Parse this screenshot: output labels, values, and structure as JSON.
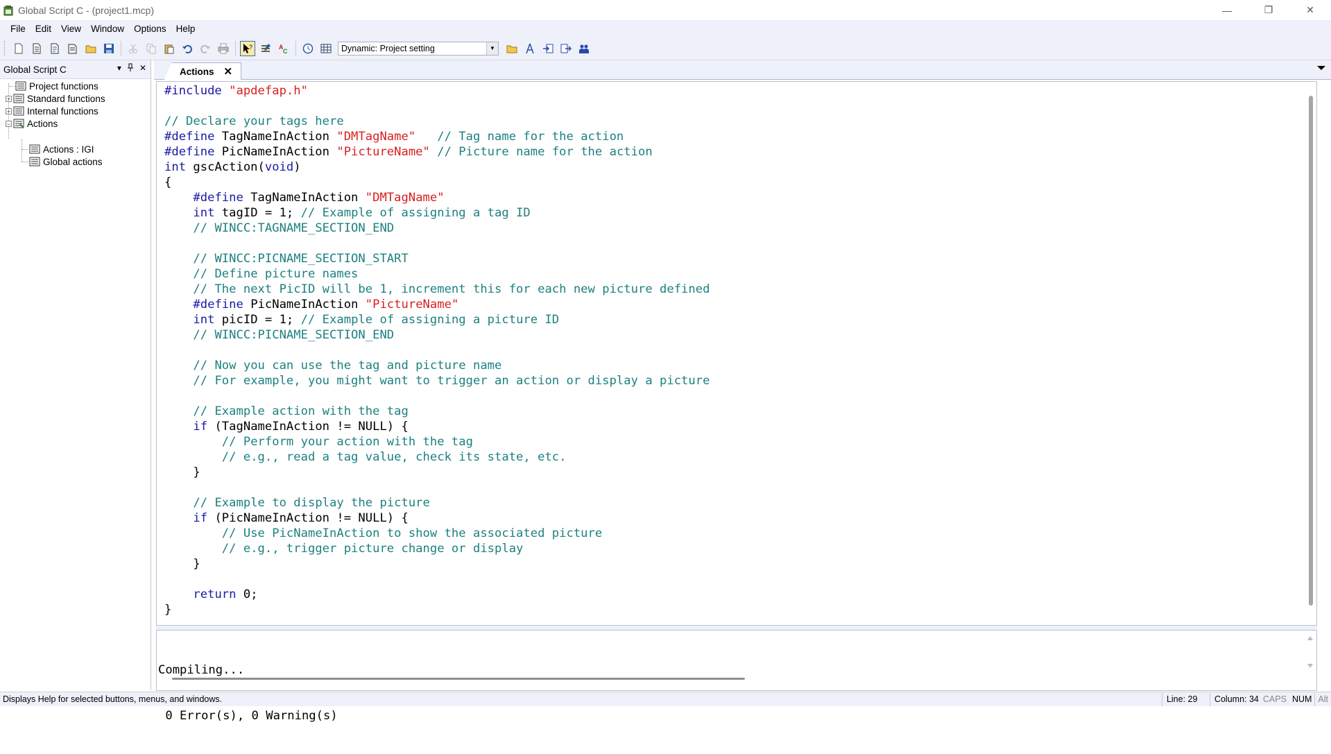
{
  "window": {
    "title": "Global Script C - (project1.mcp)",
    "minimize_glyph": "—",
    "restore_glyph": "❐",
    "close_glyph": "✕"
  },
  "menu": [
    "File",
    "Edit",
    "View",
    "Window",
    "Options",
    "Help"
  ],
  "toolbar": {
    "dynamic_combo_value": "Dynamic: Project setting"
  },
  "left_panel": {
    "title": "Global Script C",
    "ctrl_dropdown": "▾",
    "ctrl_pin": "ꟷ",
    "ctrl_close": "✕",
    "tree": [
      {
        "label": "Project functions",
        "expander": ""
      },
      {
        "label": "Standard functions",
        "expander": "+"
      },
      {
        "label": "Internal functions",
        "expander": "+"
      },
      {
        "label": "Actions",
        "expander": "−"
      },
      {
        "label": "Actions : IGI",
        "expander": ""
      },
      {
        "label": "Global actions",
        "expander": ""
      }
    ]
  },
  "tab": {
    "label": "Actions",
    "close": "✕"
  },
  "code_lines": [
    [
      {
        "t": "kw",
        "v": "#include "
      },
      {
        "t": "str",
        "v": "\"apdefap.h\""
      }
    ],
    [],
    [
      {
        "t": "cm",
        "v": "// Declare your tags here"
      }
    ],
    [
      {
        "t": "kw",
        "v": "#define"
      },
      {
        "t": "n",
        "v": " TagNameInAction "
      },
      {
        "t": "str",
        "v": "\"DMTagName\""
      },
      {
        "t": "n",
        "v": "   "
      },
      {
        "t": "cm",
        "v": "// Tag name for the action"
      }
    ],
    [
      {
        "t": "kw",
        "v": "#define"
      },
      {
        "t": "n",
        "v": " PicNameInAction "
      },
      {
        "t": "str",
        "v": "\"PictureName\""
      },
      {
        "t": "n",
        "v": " "
      },
      {
        "t": "cm",
        "v": "// Picture name for the action"
      }
    ],
    [
      {
        "t": "kw",
        "v": "int"
      },
      {
        "t": "n",
        "v": " gscAction("
      },
      {
        "t": "kw",
        "v": "void"
      },
      {
        "t": "n",
        "v": ")"
      }
    ],
    [
      {
        "t": "n",
        "v": "{"
      }
    ],
    [
      {
        "t": "n",
        "v": "    "
      },
      {
        "t": "kw",
        "v": "#define"
      },
      {
        "t": "n",
        "v": " TagNameInAction "
      },
      {
        "t": "str",
        "v": "\"DMTagName\""
      }
    ],
    [
      {
        "t": "n",
        "v": "    "
      },
      {
        "t": "kw",
        "v": "int"
      },
      {
        "t": "n",
        "v": " tagID = 1; "
      },
      {
        "t": "cm",
        "v": "// Example of assigning a tag ID"
      }
    ],
    [
      {
        "t": "n",
        "v": "    "
      },
      {
        "t": "cm",
        "v": "// WINCC:TAGNAME_SECTION_END"
      }
    ],
    [],
    [
      {
        "t": "n",
        "v": "    "
      },
      {
        "t": "cm",
        "v": "// WINCC:PICNAME_SECTION_START"
      }
    ],
    [
      {
        "t": "n",
        "v": "    "
      },
      {
        "t": "cm",
        "v": "// Define picture names"
      }
    ],
    [
      {
        "t": "n",
        "v": "    "
      },
      {
        "t": "cm",
        "v": "// The next PicID will be 1, increment this for each new picture defined"
      }
    ],
    [
      {
        "t": "n",
        "v": "    "
      },
      {
        "t": "kw",
        "v": "#define"
      },
      {
        "t": "n",
        "v": " PicNameInAction "
      },
      {
        "t": "str",
        "v": "\"PictureName\""
      }
    ],
    [
      {
        "t": "n",
        "v": "    "
      },
      {
        "t": "kw",
        "v": "int"
      },
      {
        "t": "n",
        "v": " picID = 1; "
      },
      {
        "t": "cm",
        "v": "// Example of assigning a picture ID"
      }
    ],
    [
      {
        "t": "n",
        "v": "    "
      },
      {
        "t": "cm",
        "v": "// WINCC:PICNAME_SECTION_END"
      }
    ],
    [],
    [
      {
        "t": "n",
        "v": "    "
      },
      {
        "t": "cm",
        "v": "// Now you can use the tag and picture name"
      }
    ],
    [
      {
        "t": "n",
        "v": "    "
      },
      {
        "t": "cm",
        "v": "// For example, you might want to trigger an action or display a picture"
      }
    ],
    [],
    [
      {
        "t": "n",
        "v": "    "
      },
      {
        "t": "cm",
        "v": "// Example action with the tag"
      }
    ],
    [
      {
        "t": "n",
        "v": "    "
      },
      {
        "t": "kw",
        "v": "if"
      },
      {
        "t": "n",
        "v": " (TagNameInAction != NULL) {"
      }
    ],
    [
      {
        "t": "n",
        "v": "        "
      },
      {
        "t": "cm",
        "v": "// Perform your action with the tag"
      }
    ],
    [
      {
        "t": "n",
        "v": "        "
      },
      {
        "t": "cm",
        "v": "// e.g., read a tag value, check its state, etc."
      }
    ],
    [
      {
        "t": "n",
        "v": "    }"
      }
    ],
    [],
    [
      {
        "t": "n",
        "v": "    "
      },
      {
        "t": "cm",
        "v": "// Example to display the picture"
      }
    ],
    [
      {
        "t": "n",
        "v": "    "
      },
      {
        "t": "kw",
        "v": "if"
      },
      {
        "t": "n",
        "v": " (PicNameInAction != NULL) {"
      }
    ],
    [
      {
        "t": "n",
        "v": "        "
      },
      {
        "t": "cm",
        "v": "// Use PicNameInAction to show the associated picture"
      }
    ],
    [
      {
        "t": "n",
        "v": "        "
      },
      {
        "t": "cm",
        "v": "// e.g., trigger picture change or display"
      }
    ],
    [
      {
        "t": "n",
        "v": "    }"
      }
    ],
    [],
    [
      {
        "t": "n",
        "v": "    "
      },
      {
        "t": "kw",
        "v": "return"
      },
      {
        "t": "n",
        "v": " 0;"
      }
    ],
    [
      {
        "t": "n",
        "v": "}"
      }
    ]
  ],
  "output": {
    "line1": "Compiling...",
    "line2": " 0 Error(s), 0 Warning(s)"
  },
  "status": {
    "message": "Displays Help for selected buttons, menus, and windows.",
    "line": "Line: 29",
    "column": "Column: 34",
    "caps": "CAPS",
    "num": "NUM",
    "alt": "Alt"
  },
  "colors": {
    "keyword": "#1a1aa6",
    "string": "#d72020",
    "comment": "#1e8080",
    "chrome": "#eef0fa"
  }
}
